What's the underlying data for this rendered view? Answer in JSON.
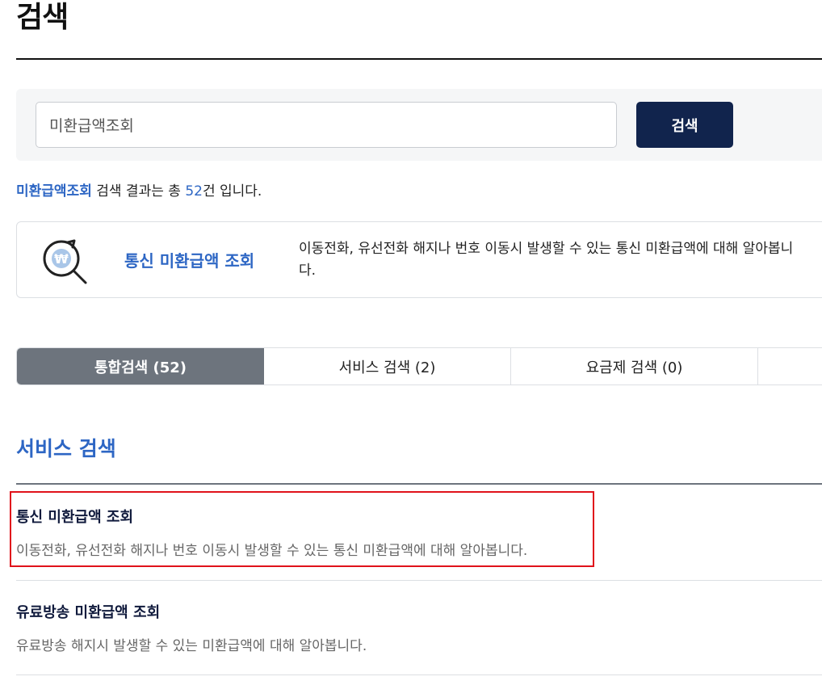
{
  "page": {
    "title": "검색"
  },
  "search": {
    "value": "미환급액조회",
    "button_label": "검색"
  },
  "summary": {
    "keyword": "미환급액조회",
    "text_before_count": " 검색 결과는 총 ",
    "count": "52",
    "text_after_count": "건 입니다."
  },
  "featured": {
    "icon": "won-magnifier-icon",
    "title": "통신 미환급액 조회",
    "description": "이동전화, 유선전화 해지나 번호 이동시 발생할 수 있는 통신 미환급액에 대해 알아봅니다."
  },
  "tabs": [
    {
      "label": "통합검색 (52)",
      "active": true
    },
    {
      "label": "서비스 검색 (2)",
      "active": false
    },
    {
      "label": "요금제 검색 (0)",
      "active": false
    }
  ],
  "section": {
    "title": "서비스 검색"
  },
  "results": [
    {
      "title": "통신 미환급액 조회",
      "description": "이동전화, 유선전화 해지나 번호 이동시 발생할 수 있는 통신 미환급액에 대해 알아봅니다."
    },
    {
      "title": "유료방송 미환급액 조회",
      "description": "유료방송 해지시 발생할 수 있는 미환급액에 대해 알아봅니다."
    }
  ],
  "colors": {
    "accent": "#2d66c4",
    "button": "#11244d",
    "active_tab": "#6d747d",
    "highlight": "#e0121b"
  }
}
